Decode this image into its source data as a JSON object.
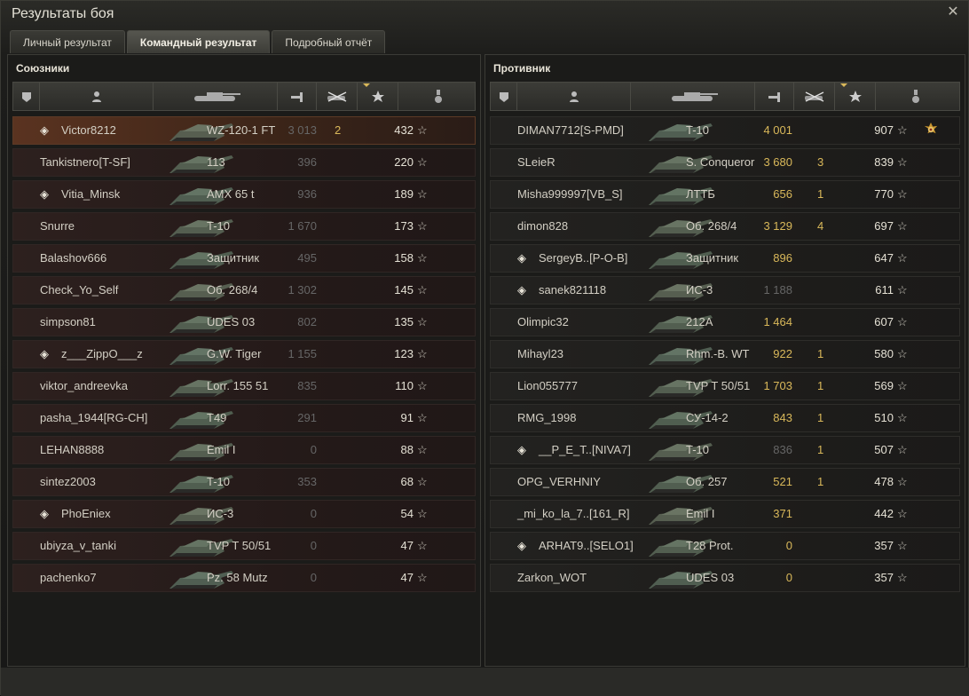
{
  "window": {
    "title": "Результаты боя"
  },
  "tabs": [
    "Личный результат",
    "Командный результат",
    "Подробный отчёт"
  ],
  "allies": {
    "title": "Союзники",
    "rows": [
      {
        "name": "Victor8212",
        "platoon": true,
        "tank": "WZ-120-1 FT",
        "dmg": "3 013",
        "frags": "2",
        "xp": "432",
        "me": true
      },
      {
        "name": "Tankistnero[T-SF]",
        "platoon": false,
        "tank": "113",
        "dmg": "396",
        "frags": "",
        "xp": "220"
      },
      {
        "name": "Vitia_Minsk",
        "platoon": true,
        "tank": "AMX 65 t",
        "dmg": "936",
        "frags": "",
        "xp": "189"
      },
      {
        "name": "Snurre",
        "platoon": false,
        "tank": "T-10",
        "dmg": "1 670",
        "frags": "",
        "xp": "173"
      },
      {
        "name": "Balashov666",
        "platoon": false,
        "tank": "Защитник",
        "dmg": "495",
        "frags": "",
        "xp": "158"
      },
      {
        "name": "Check_Yo_Self",
        "platoon": false,
        "tank": "Об. 268/4",
        "dmg": "1 302",
        "frags": "",
        "xp": "145"
      },
      {
        "name": "simpson81",
        "platoon": false,
        "tank": "UDES 03",
        "dmg": "802",
        "frags": "",
        "xp": "135"
      },
      {
        "name": "z___ZippO___z",
        "platoon": true,
        "tank": "G.W. Tiger",
        "dmg": "1 155",
        "frags": "",
        "xp": "123"
      },
      {
        "name": "viktor_andreevka",
        "platoon": false,
        "tank": "Lorr. 155 51",
        "dmg": "835",
        "frags": "",
        "xp": "110"
      },
      {
        "name": "pasha_1944[RG-CH]",
        "platoon": false,
        "tank": "T49",
        "dmg": "291",
        "frags": "",
        "xp": "91"
      },
      {
        "name": "LEHAN8888",
        "platoon": false,
        "tank": "Emil I",
        "dmg": "0",
        "frags": "",
        "xp": "88"
      },
      {
        "name": "sintez2003",
        "platoon": false,
        "tank": "T-10",
        "dmg": "353",
        "frags": "",
        "xp": "68"
      },
      {
        "name": "PhoEniex",
        "platoon": true,
        "tank": "ИС-3",
        "dmg": "0",
        "frags": "",
        "xp": "54"
      },
      {
        "name": "ubiyza_v_tanki",
        "platoon": false,
        "tank": "TVP T 50/51",
        "dmg": "0",
        "frags": "",
        "xp": "47"
      },
      {
        "name": "pachenko7",
        "platoon": false,
        "tank": "Pz. 58 Mutz",
        "dmg": "0",
        "frags": "",
        "xp": "47"
      }
    ]
  },
  "enemies": {
    "title": "Противник",
    "rows": [
      {
        "name": "DIMAN7712[S-PMD]",
        "platoon": false,
        "tank": "T-10",
        "dmg": "4 001",
        "frags": "",
        "xp": "907",
        "lit": true,
        "medal": true
      },
      {
        "name": "SLeieR",
        "platoon": false,
        "tank": "S. Conqueror",
        "dmg": "3 680",
        "frags": "3",
        "xp": "839",
        "lit": true
      },
      {
        "name": "Misha999997[VB_S]",
        "platoon": false,
        "tank": "ЛТТБ",
        "dmg": "656",
        "frags": "1",
        "xp": "770",
        "lit": true
      },
      {
        "name": "dimon828",
        "platoon": false,
        "tank": "Об. 268/4",
        "dmg": "3 129",
        "frags": "4",
        "xp": "697",
        "lit": true
      },
      {
        "name": "SergeyB..[P-O-B]",
        "platoon": true,
        "tank": "Защитник",
        "dmg": "896",
        "frags": "",
        "xp": "647",
        "lit": true
      },
      {
        "name": "sanek821118",
        "platoon": true,
        "tank": "ИС-3",
        "dmg": "1 188",
        "frags": "",
        "xp": "611",
        "lit": false
      },
      {
        "name": "Olimpic32",
        "platoon": false,
        "tank": "212A",
        "dmg": "1 464",
        "frags": "",
        "xp": "607",
        "lit": true
      },
      {
        "name": "Mihayl23",
        "platoon": false,
        "tank": "Rhm.-B. WT",
        "dmg": "922",
        "frags": "1",
        "xp": "580",
        "lit": true
      },
      {
        "name": "Lion055777",
        "platoon": false,
        "tank": "TVP T 50/51",
        "dmg": "1 703",
        "frags": "1",
        "xp": "569",
        "lit": true
      },
      {
        "name": "RMG_1998",
        "platoon": false,
        "tank": "СУ-14-2",
        "dmg": "843",
        "frags": "1",
        "xp": "510",
        "lit": true
      },
      {
        "name": "__P_E_T..[NIVA7]",
        "platoon": true,
        "tank": "T-10",
        "dmg": "836",
        "frags": "1",
        "xp": "507",
        "lit": false
      },
      {
        "name": "OPG_VERHNIY",
        "platoon": false,
        "tank": "Об. 257",
        "dmg": "521",
        "frags": "1",
        "xp": "478",
        "lit": true
      },
      {
        "name": "_mi_ko_la_7..[161_R]",
        "platoon": false,
        "tank": "Emil I",
        "dmg": "371",
        "frags": "",
        "xp": "442",
        "lit": true
      },
      {
        "name": "ARHAT9..[SELO1]",
        "platoon": true,
        "tank": "T28 Prot.",
        "dmg": "0",
        "frags": "",
        "xp": "357",
        "lit": true
      },
      {
        "name": "Zarkon_WOT",
        "platoon": false,
        "tank": "UDES 03",
        "dmg": "0",
        "frags": "",
        "xp": "357",
        "lit": true
      }
    ]
  },
  "icons": {
    "close": "close-icon",
    "platoon": "platoon-icon",
    "star": "experience-star-icon",
    "medal": "medal-icon"
  },
  "colors": {
    "accent": "#d9b85a",
    "self_row": "#5a3320"
  },
  "star_glyph": "☆",
  "platoon_glyph": "◈",
  "close_glyph": "✕"
}
